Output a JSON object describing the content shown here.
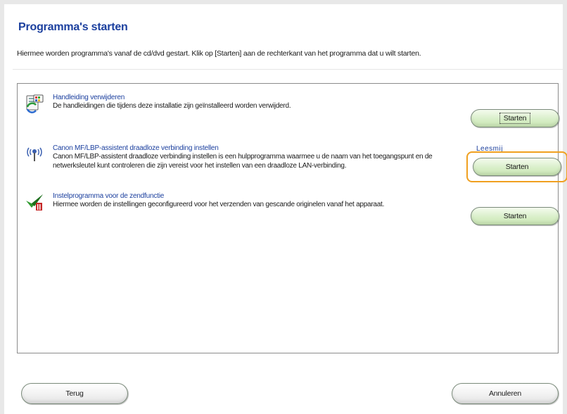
{
  "page": {
    "title": "Programma's starten",
    "description": "Hiermee worden programma's vanaf de cd/dvd gestart. Klik op [Starten] aan de rechterkant van het programma dat u wilt starten."
  },
  "programs": [
    {
      "title": "Handleiding verwijderen",
      "description": "De handleidingen die tijdens deze installatie zijn geïnstalleerd worden verwijderd.",
      "icon": "uninstall-manual-icon",
      "button_label": "Starten"
    },
    {
      "title": "Canon MF/LBP-assistent draadloze verbinding instellen",
      "description": "Canon MF/LBP-assistent draadloze verbinding instellen is een hulpprogramma waarmee u de naam van het toegangspunt en de netwerksleutel kunt controleren die zijn vereist voor het instellen van een draadloze LAN-verbinding.",
      "icon": "wireless-antenna-icon",
      "button_label": "Starten",
      "readme_label": "Leesmij"
    },
    {
      "title": "Instelprogramma voor de zendfunctie",
      "description": "Hiermee worden de instellingen geconfigureerd voor het verzenden van gescande originelen vanaf het apparaat.",
      "icon": "send-setup-icon",
      "button_label": "Starten"
    }
  ],
  "footer": {
    "back_label": "Terug",
    "cancel_label": "Annuleren"
  },
  "colors": {
    "title": "#1b3f9e",
    "highlight": "#f0a020",
    "button_green": "#d9efc9"
  }
}
